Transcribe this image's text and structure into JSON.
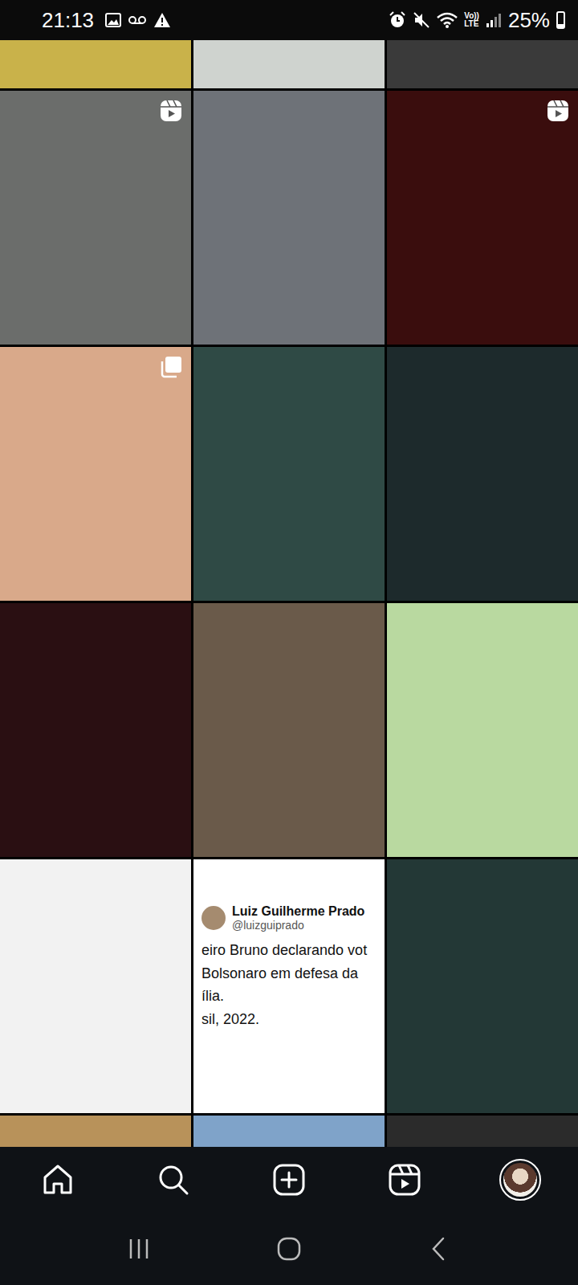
{
  "status_bar": {
    "time": "21:13",
    "network": [
      "Vo))",
      "LTE"
    ],
    "battery": "25%",
    "battery_level": 0.25
  },
  "posts": [
    {
      "kind": "photo",
      "badge": "none",
      "color": "#c9b24a"
    },
    {
      "kind": "photo",
      "badge": "none",
      "color": "#cfd3cf"
    },
    {
      "kind": "photo",
      "badge": "none",
      "color": "#3a3a3a"
    },
    {
      "kind": "photo",
      "badge": "reel",
      "color": "#6b6d6b"
    },
    {
      "kind": "photo",
      "badge": "none",
      "color": "#6e7278"
    },
    {
      "kind": "photo",
      "badge": "reel",
      "color": "#3a0d0d"
    },
    {
      "kind": "photo",
      "badge": "carousel",
      "color": "#d9a98a"
    },
    {
      "kind": "photo",
      "badge": "none",
      "color": "#2f4a45"
    },
    {
      "kind": "photo",
      "badge": "none",
      "color": "#1d2a2c"
    },
    {
      "kind": "photo",
      "badge": "none",
      "color": "#2a0f12"
    },
    {
      "kind": "photo",
      "badge": "none",
      "color": "#6a5a4a"
    },
    {
      "kind": "photo",
      "badge": "none",
      "color": "#b9d9a0"
    },
    {
      "kind": "photo",
      "badge": "none",
      "color": "#f2f2f2"
    },
    {
      "kind": "tweet",
      "badge": "none",
      "color": "#ffffff",
      "author": "Luiz Guilherme Prado",
      "handle": "@luizguiprado",
      "lines": [
        "eiro Bruno declarando vot",
        "Bolsonaro em defesa da",
        "ília.",
        "sil, 2022."
      ]
    },
    {
      "kind": "photo",
      "badge": "none",
      "color": "#233836"
    },
    {
      "kind": "photo",
      "badge": "none",
      "color": "#b8925a"
    },
    {
      "kind": "photo",
      "badge": "none",
      "color": "#7fa3c9"
    },
    {
      "kind": "photo",
      "badge": "none",
      "color": "#2b2b2b"
    }
  ],
  "bottom_nav": [
    {
      "kind": "home",
      "selected": false
    },
    {
      "kind": "search",
      "selected": false
    },
    {
      "kind": "create",
      "selected": false
    },
    {
      "kind": "reels",
      "selected": false
    },
    {
      "kind": "profile",
      "selected": true
    }
  ]
}
